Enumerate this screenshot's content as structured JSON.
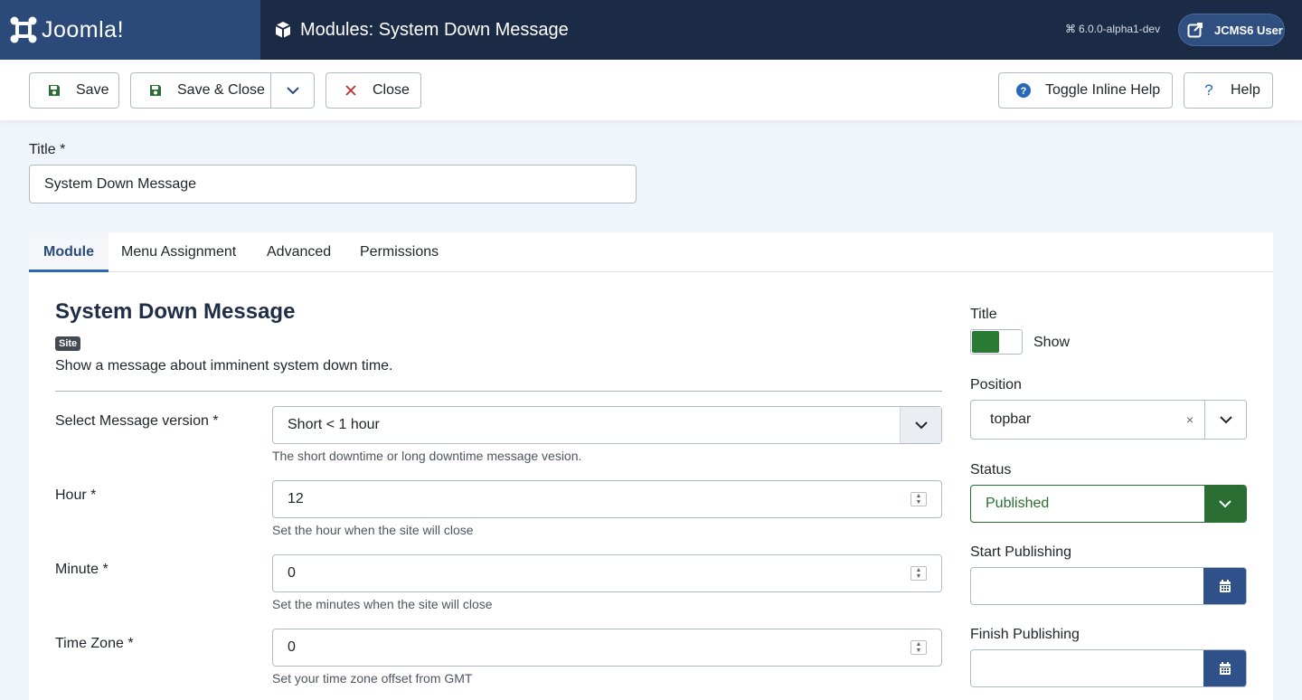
{
  "header": {
    "logo_text": "Joomla!",
    "page_title": "Modules: System Down Message",
    "version": "6.0.0-alpha1-dev",
    "user_label": "JCMS6 User"
  },
  "toolbar": {
    "save_label": "Save",
    "save_close_label": "Save & Close",
    "close_label": "Close",
    "toggle_help_label": "Toggle Inline Help",
    "help_label": "Help"
  },
  "title_field": {
    "label": "Title *",
    "value": "System Down Message"
  },
  "tabs": [
    {
      "label": "Module",
      "active": true
    },
    {
      "label": "Menu Assignment",
      "active": false
    },
    {
      "label": "Advanced",
      "active": false
    },
    {
      "label": "Permissions",
      "active": false
    }
  ],
  "module": {
    "heading": "System Down Message",
    "badge": "Site",
    "description": "Show a message about imminent system down time."
  },
  "fields": [
    {
      "label": "Select Message version *",
      "value": "Short < 1 hour",
      "help": "The short downtime or long downtime message vesion.",
      "type": "select"
    },
    {
      "label": "Hour *",
      "value": "12",
      "help": "Set the hour when the site will close",
      "type": "number"
    },
    {
      "label": "Minute *",
      "value": "0",
      "help": "Set the minutes when the site will close",
      "type": "number"
    },
    {
      "label": "Time Zone *",
      "value": "0",
      "help": "Set your time zone offset from GMT",
      "type": "number"
    }
  ],
  "sidebar": {
    "title_label": "Title",
    "title_toggle_text": "Show",
    "position_label": "Position",
    "position_value": "topbar",
    "position_clear": "×",
    "status_label": "Status",
    "status_value": "Published",
    "start_label": "Start Publishing",
    "start_value": "",
    "finish_label": "Finish Publishing",
    "finish_value": ""
  },
  "colors": {
    "header_bg": "#1b2a45",
    "logo_bg": "#2b4a7a",
    "accent": "#2a69b8",
    "status_green": "#2b6e33",
    "date_button": "#2f5089"
  }
}
